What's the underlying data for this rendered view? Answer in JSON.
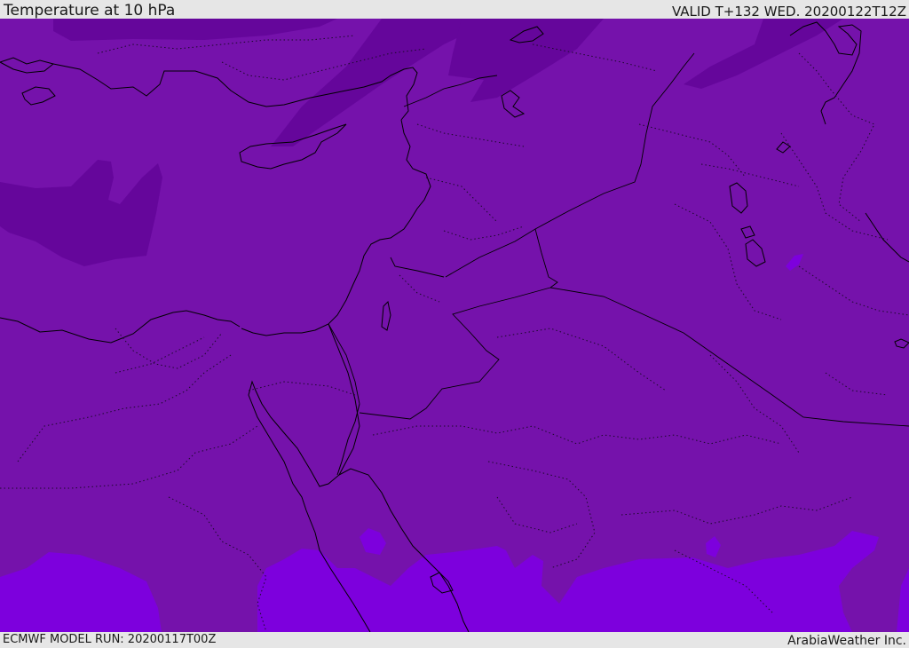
{
  "header": {
    "title": "Temperature at 10 hPa",
    "valid": "VALID T+132 WED. 20200122T12Z"
  },
  "footer": {
    "model_run": "ECMWF MODEL RUN: 20200117T00Z",
    "credit": "ArabiaWeather Inc."
  },
  "map": {
    "base_color": "#7512ab",
    "cold_band_color": "#65069b",
    "warm_patch_color": "#7d00dd",
    "coastline_color": "#000000",
    "border_style": "dotted"
  }
}
